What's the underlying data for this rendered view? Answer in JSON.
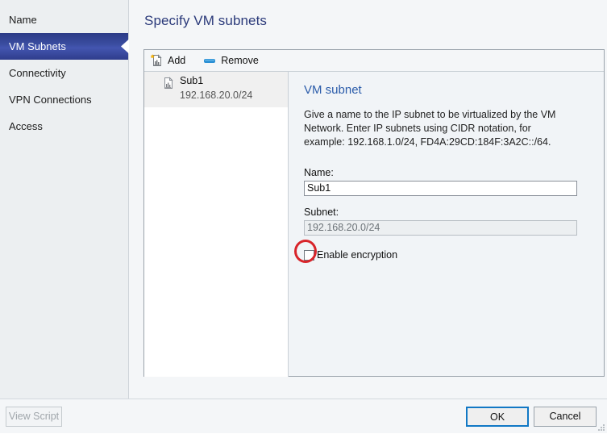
{
  "window": {
    "title": "Specify VM subnets"
  },
  "sidebar": {
    "items": [
      {
        "label": "Name",
        "selected": false
      },
      {
        "label": "VM Subnets",
        "selected": true
      },
      {
        "label": "Connectivity",
        "selected": false
      },
      {
        "label": "VPN Connections",
        "selected": false
      },
      {
        "label": "Access",
        "selected": false
      }
    ]
  },
  "toolbar": {
    "add_label": "Add",
    "add_icon": "add-subnet-icon",
    "remove_label": "Remove",
    "remove_icon": "remove-icon"
  },
  "list": {
    "items": [
      {
        "icon": "subnet-icon",
        "title": "Sub1",
        "subtitle": "192.168.20.0/24",
        "selected": true
      }
    ]
  },
  "detail": {
    "title": "VM subnet",
    "description": "Give a name to the IP subnet to be virtualized by the VM Network. Enter IP subnets using CIDR notation, for example: 192.168.1.0/24, FD4A:29CD:184F:3A2C::/64.",
    "name_label": "Name:",
    "name_value": "Sub1",
    "name_placeholder": "",
    "subnet_label": "Subnet:",
    "subnet_value": "192.168.20.0/24",
    "subnet_placeholder": "",
    "checkbox_label": "Enable encryption",
    "checkbox_checked": false
  },
  "footer": {
    "view_script_label": "View Script",
    "ok_label": "OK",
    "cancel_label": "Cancel"
  },
  "annotation": {
    "color": "#d8242a",
    "target": "enable-encryption-checkbox"
  },
  "colors": {
    "accent_selected_nav": "#3c4fa3",
    "title_text": "#2b3a7a",
    "detail_title_text": "#2b5caa",
    "default_button_border": "#1178c5",
    "panel_background": "#f1f4f7"
  }
}
